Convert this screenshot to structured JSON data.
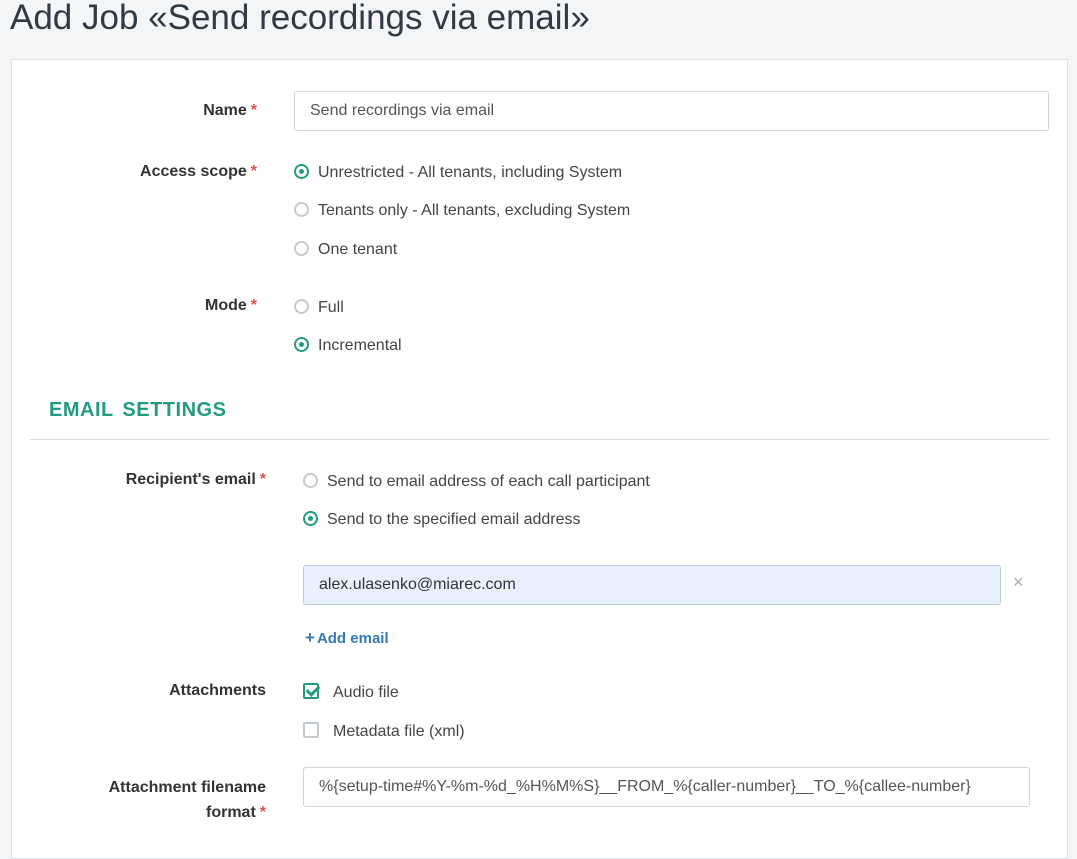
{
  "page": {
    "title": "Add Job «Send recordings via email»"
  },
  "form": {
    "name": {
      "label": "Name",
      "required": "*",
      "value": "Send recordings via email"
    },
    "access_scope": {
      "label": "Access scope",
      "required": "*",
      "options": [
        "Unrestricted - All tenants, including System",
        "Tenants only - All tenants, excluding System",
        "One tenant"
      ],
      "selected": 0
    },
    "mode": {
      "label": "Mode",
      "required": "*",
      "options": [
        "Full",
        "Incremental"
      ],
      "selected": 1
    },
    "email_section": {
      "title": "EMAIL SETTINGS"
    },
    "recipient": {
      "label": "Recipient's email",
      "required": "*",
      "options": [
        "Send to email address of each call participant",
        "Send to the specified email address"
      ],
      "selected": 1,
      "email_value": "alex.ulasenko@miarec.com",
      "remove_icon": "×",
      "add_email": {
        "icon": "+",
        "label": "Add email"
      }
    },
    "attachments": {
      "label": "Attachments",
      "options": [
        {
          "label": "Audio file",
          "checked": true
        },
        {
          "label": "Metadata file (xml)",
          "checked": false
        }
      ]
    },
    "filename_format": {
      "label_line1": "Attachment filename",
      "label_line2": "format",
      "required": "*",
      "value": "%{setup-time#%Y-%m-%d_%H%M%S}__FROM_%{caller-number}__TO_%{callee-number}"
    }
  },
  "colors": {
    "accent": "#239a82",
    "link": "#337ab7",
    "required": "#d9534f"
  }
}
